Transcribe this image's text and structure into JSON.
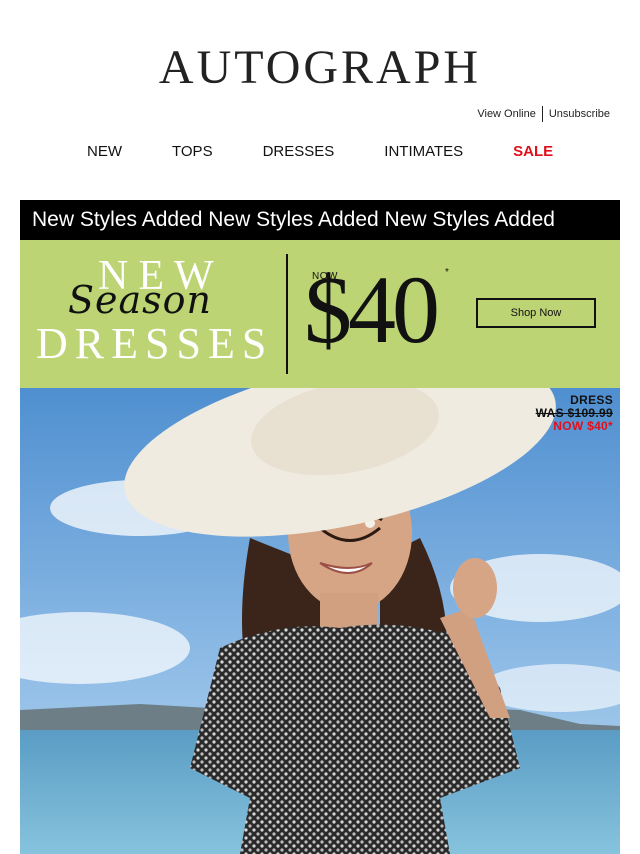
{
  "header": {
    "logo": "AUTOGRAPH",
    "view_online": "View Online",
    "unsubscribe": "Unsubscribe"
  },
  "nav": {
    "items": [
      "NEW",
      "TOPS",
      "DRESSES",
      "INTIMATES",
      "SALE"
    ]
  },
  "ticker": {
    "text": "New Styles Added New Styles Added New Styles Added"
  },
  "banner": {
    "new": "NEW",
    "season": "Season",
    "dresses": "DRESSES",
    "now_label": "NOW",
    "price": "$40",
    "asterisk": "*",
    "cta": "Shop Now"
  },
  "hero": {
    "product": "DRESS",
    "was": "WAS $109.99",
    "now": "NOW $40*"
  },
  "colors": {
    "banner_bg": "#bcd474",
    "sale_red": "#e0101a",
    "ticker_bg": "#000000"
  }
}
